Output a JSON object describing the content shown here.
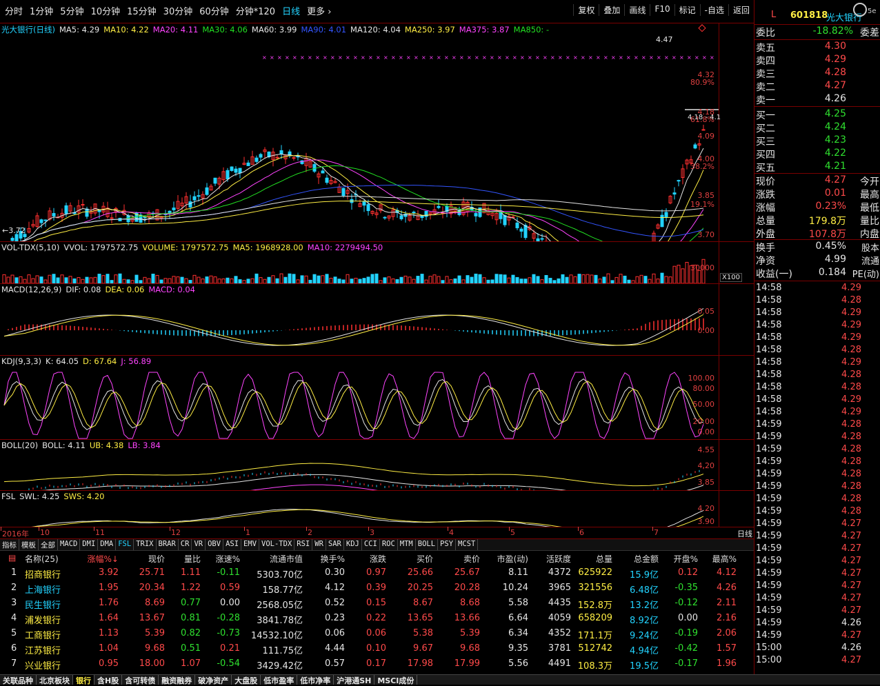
{
  "topbar": {
    "tabs": [
      "分时",
      "1分钟",
      "5分钟",
      "10分钟",
      "15分钟",
      "30分钟",
      "60分钟",
      "分钟*120",
      "日线",
      "更多 ›"
    ],
    "active_tab": "日线",
    "buttons": [
      "复权",
      "叠加",
      "画线",
      "F10",
      "标记",
      "-自选",
      "返回"
    ]
  },
  "main_pane": {
    "title": "光大银行(日线)",
    "ma": [
      {
        "label": "MA5: 4.29",
        "color": "#e6e6e6"
      },
      {
        "label": "MA10: 4.22",
        "color": "#ffee44"
      },
      {
        "label": "MA20: 4.11",
        "color": "#ff44ff"
      },
      {
        "label": "MA30: 4.06",
        "color": "#22e022"
      },
      {
        "label": "MA60: 3.99",
        "color": "#e6e6e6"
      },
      {
        "label": "MA90: 4.01",
        "color": "#3355ff"
      },
      {
        "label": "MA120: 4.04",
        "color": "#e6e6e6"
      },
      {
        "label": "MA250: 3.97",
        "color": "#ffee44"
      },
      {
        "label": "MA375: 3.87",
        "color": "#ff44ff"
      },
      {
        "label": "MA850: -",
        "color": "#22e022"
      }
    ],
    "price_axis": [
      "4.32",
      "4.18",
      "4.09",
      "4.00",
      "3.85",
      "3.70"
    ],
    "pct_axis": [
      "80.9%",
      "61.8%",
      "38.2%",
      "19.1%"
    ],
    "high_label": "4.47",
    "low_label": "←3.72",
    "range_label": "4.18 - 4.1"
  },
  "vol_pane": {
    "title": "VOL-TDX(5,10)",
    "items": [
      {
        "label": "VVOL: 1797572.75",
        "color": "#e6e6e6"
      },
      {
        "label": "VOLUME: 1797572.75",
        "color": "#ffee44"
      },
      {
        "label": "MA5: 1968928.00",
        "color": "#ffee44"
      },
      {
        "label": "MA10: 2279494.50",
        "color": "#ff44ff"
      }
    ],
    "axis": [
      "30000"
    ],
    "unit": "X100"
  },
  "macd_pane": {
    "title": "MACD(12,26,9)",
    "items": [
      {
        "label": "DIF: 0.08",
        "color": "#e6e6e6"
      },
      {
        "label": "DEA: 0.06",
        "color": "#ffee44"
      },
      {
        "label": "MACD: 0.04",
        "color": "#ff44ff"
      }
    ],
    "axis": [
      "0.05",
      "0.00"
    ]
  },
  "kdj_pane": {
    "title": "KDJ(9,3,3)",
    "items": [
      {
        "label": "K: 64.05",
        "color": "#e6e6e6"
      },
      {
        "label": "D: 67.64",
        "color": "#ffee44"
      },
      {
        "label": "J: 56.89",
        "color": "#ff44ff"
      }
    ],
    "axis": [
      "100.00",
      "80.00",
      "50.00",
      "20.00",
      "0.00"
    ]
  },
  "boll_pane": {
    "title": "BOLL(20)",
    "items": [
      {
        "label": "BOLL: 4.11",
        "color": "#e6e6e6"
      },
      {
        "label": "UB: 4.38",
        "color": "#ffee44"
      },
      {
        "label": "LB: 3.84",
        "color": "#ff44ff"
      }
    ],
    "axis": [
      "4.55",
      "4.20",
      "3.85"
    ]
  },
  "fsl_pane": {
    "title": "FSL",
    "items": [
      {
        "label": "SWL: 4.25",
        "color": "#e6e6e6"
      },
      {
        "label": "SWS: 4.20",
        "color": "#ffee44"
      }
    ],
    "axis": [
      "4.20",
      "3.90"
    ]
  },
  "date_axis": {
    "labels": [
      "2016年",
      "10",
      "11",
      "12",
      "1",
      "2",
      "3",
      "4",
      "5",
      "6",
      "7"
    ],
    "period": "日线"
  },
  "indicator_tabs": [
    "指标",
    "模板",
    "全部",
    "MACD",
    "DMI",
    "DMA",
    "FSL",
    "TRIX",
    "BRAR",
    "CR",
    "VR",
    "OBV",
    "ASI",
    "EMV",
    "VOL-TDX",
    "RSI",
    "WR",
    "SAR",
    "KDJ",
    "CCI",
    "ROC",
    "MTM",
    "BOLL",
    "PSY",
    "MCST"
  ],
  "indicator_selected": "FSL",
  "table": {
    "headers": [
      "名称(25)",
      "涨幅%↓",
      "现价",
      "量比",
      "涨速%",
      "流通市值",
      "换手%",
      "涨跌",
      "买价",
      "卖价",
      "市盈(动)",
      "活跃度",
      "总量",
      "总金额",
      "开盘%",
      "最高%"
    ],
    "rows": [
      {
        "n": "1",
        "name": "招商银行",
        "chg": "3.92",
        "price": "25.71",
        "vr": "1.11",
        "spd": "-0.11",
        "mcap": "5303.70亿",
        "turn": "0.30",
        "diff": "0.97",
        "bid": "25.66",
        "ask": "25.67",
        "pe": "8.11",
        "act": "4372",
        "vol": "625922",
        "amt": "15.9亿",
        "open": "0.12",
        "high": "4.12"
      },
      {
        "n": "2",
        "name": "上海银行",
        "chg": "1.95",
        "price": "20.34",
        "vr": "1.22",
        "spd": "0.59",
        "mcap": "158.77亿",
        "turn": "4.12",
        "diff": "0.39",
        "bid": "20.25",
        "ask": "20.28",
        "pe": "10.24",
        "act": "3965",
        "vol": "321556",
        "amt": "6.48亿",
        "open": "-0.35",
        "high": "4.26"
      },
      {
        "n": "3",
        "name": "民生银行",
        "chg": "1.76",
        "price": "8.69",
        "vr": "0.77",
        "spd": "0.00",
        "mcap": "2568.05亿",
        "turn": "0.52",
        "diff": "0.15",
        "bid": "8.67",
        "ask": "8.68",
        "pe": "5.58",
        "act": "4435",
        "vol": "152.8万",
        "amt": "13.2亿",
        "open": "-0.12",
        "high": "2.11"
      },
      {
        "n": "4",
        "name": "浦发银行",
        "chg": "1.64",
        "price": "13.67",
        "vr": "0.81",
        "spd": "-0.28",
        "mcap": "3841.78亿",
        "turn": "0.23",
        "diff": "0.22",
        "bid": "13.65",
        "ask": "13.66",
        "pe": "6.64",
        "act": "4059",
        "vol": "658209",
        "amt": "8.92亿",
        "open": "0.00",
        "high": "2.16"
      },
      {
        "n": "5",
        "name": "工商银行",
        "chg": "1.13",
        "price": "5.39",
        "vr": "0.82",
        "spd": "-0.73",
        "mcap": "14532.10亿",
        "turn": "0.06",
        "diff": "0.06",
        "bid": "5.38",
        "ask": "5.39",
        "pe": "6.34",
        "act": "4352",
        "vol": "171.1万",
        "amt": "9.24亿",
        "open": "-0.19",
        "high": "2.06"
      },
      {
        "n": "6",
        "name": "江苏银行",
        "chg": "1.04",
        "price": "9.68",
        "vr": "0.51",
        "spd": "0.21",
        "mcap": "111.75亿",
        "turn": "4.44",
        "diff": "0.10",
        "bid": "9.67",
        "ask": "9.68",
        "pe": "9.35",
        "act": "3781",
        "vol": "512742",
        "amt": "4.94亿",
        "open": "-0.42",
        "high": "1.57"
      },
      {
        "n": "7",
        "name": "兴业银行",
        "chg": "0.95",
        "price": "18.00",
        "vr": "1.07",
        "spd": "-0.54",
        "mcap": "3429.42亿",
        "turn": "0.57",
        "diff": "0.17",
        "bid": "17.98",
        "ask": "17.99",
        "pe": "5.56",
        "act": "4491",
        "vol": "108.3万",
        "amt": "19.5亿",
        "open": "-0.17",
        "high": "1.96"
      }
    ]
  },
  "bottom_tabs": [
    "关联品种",
    "北京板块",
    "银行",
    "含H股",
    "含可转债",
    "融资融券",
    "破净资产",
    "大盘股",
    "低市盈率",
    "低市净率",
    "沪港通SH",
    "MSCI成份"
  ],
  "bottom_selected": "银行",
  "quote": {
    "code": "601818",
    "name": "光大银行",
    "weibi_label": "委比",
    "weibi_value": "-18.82%",
    "weicha_label": "委差",
    "asks": [
      {
        "label": "卖五",
        "price": "4.30"
      },
      {
        "label": "卖四",
        "price": "4.29"
      },
      {
        "label": "卖三",
        "price": "4.28"
      },
      {
        "label": "卖二",
        "price": "4.27"
      },
      {
        "label": "卖一",
        "price": "4.26"
      }
    ],
    "bids": [
      {
        "label": "买一",
        "price": "4.25"
      },
      {
        "label": "买二",
        "price": "4.24"
      },
      {
        "label": "买三",
        "price": "4.23"
      },
      {
        "label": "买四",
        "price": "4.22"
      },
      {
        "label": "买五",
        "price": "4.21"
      }
    ],
    "stats": [
      {
        "l": "现价",
        "v": "4.27",
        "r": "今开",
        "c": "#ff4a4a"
      },
      {
        "l": "涨跌",
        "v": "0.01",
        "r": "最高",
        "c": "#ff4a4a"
      },
      {
        "l": "涨幅",
        "v": "0.23%",
        "r": "最低",
        "c": "#ff4a4a"
      },
      {
        "l": "总量",
        "v": "179.8万",
        "r": "量比",
        "c": "#ffee44"
      },
      {
        "l": "外盘",
        "v": "107.8万",
        "r": "内盘",
        "c": "#ff4a4a"
      }
    ],
    "stats2": [
      {
        "l": "换手",
        "v": "0.45%",
        "r": "股本"
      },
      {
        "l": "净资",
        "v": "4.99",
        "r": "流通"
      },
      {
        "l": "收益(一)",
        "v": "0.184",
        "r": "PE(动)"
      }
    ],
    "ticks": [
      {
        "t": "14:58",
        "p": "4.29"
      },
      {
        "t": "14:58",
        "p": "4.28"
      },
      {
        "t": "14:58",
        "p": "4.29"
      },
      {
        "t": "14:58",
        "p": "4.29"
      },
      {
        "t": "14:58",
        "p": "4.29"
      },
      {
        "t": "14:58",
        "p": "4.28"
      },
      {
        "t": "14:58",
        "p": "4.29"
      },
      {
        "t": "14:58",
        "p": "4.28"
      },
      {
        "t": "14:58",
        "p": "4.28"
      },
      {
        "t": "14:58",
        "p": "4.29"
      },
      {
        "t": "14:58",
        "p": "4.29"
      },
      {
        "t": "14:59",
        "p": "4.28"
      },
      {
        "t": "14:59",
        "p": "4.28"
      },
      {
        "t": "14:59",
        "p": "4.28"
      },
      {
        "t": "14:59",
        "p": "4.28"
      },
      {
        "t": "14:59",
        "p": "4.28"
      },
      {
        "t": "14:59",
        "p": "4.28"
      },
      {
        "t": "14:59",
        "p": "4.28"
      },
      {
        "t": "14:59",
        "p": "4.28"
      },
      {
        "t": "14:59",
        "p": "4.27"
      },
      {
        "t": "14:59",
        "p": "4.27"
      },
      {
        "t": "14:59",
        "p": "4.27"
      },
      {
        "t": "14:59",
        "p": "4.27"
      },
      {
        "t": "14:59",
        "p": "4.27"
      },
      {
        "t": "14:59",
        "p": "4.27"
      },
      {
        "t": "14:59",
        "p": "4.27"
      },
      {
        "t": "14:59",
        "p": "4.27"
      },
      {
        "t": "14:59",
        "p": "4.26"
      },
      {
        "t": "14:59",
        "p": "4.27"
      },
      {
        "t": "15:00",
        "p": "4.26"
      },
      {
        "t": "15:00",
        "p": "4.27"
      }
    ]
  },
  "colors": {
    "up": "#ff4a4a",
    "down": "#2fe02f",
    "accent": "#22d3ff",
    "frame": "#7a0000"
  }
}
